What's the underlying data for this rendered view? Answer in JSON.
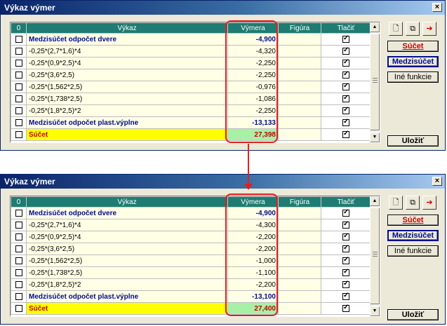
{
  "windows": [
    {
      "title": "Výkaz výmer",
      "columns": [
        "0",
        "Výkaz",
        "Výmera",
        "Figúra",
        "Tlačiť"
      ],
      "rows": [
        {
          "type": "sub",
          "vykaz": "Medzisúčet odpočet dvere",
          "vymera": "-4,900",
          "tlacit": true
        },
        {
          "type": "item",
          "vykaz": "-0,25*(2,7*1,6)*4",
          "vymera": "-4,320",
          "tlacit": true
        },
        {
          "type": "item",
          "vykaz": "-0,25*(0,9*2,5)*4",
          "vymera": "-2,250",
          "tlacit": true
        },
        {
          "type": "item",
          "vykaz": "-0,25*(3,6*2,5)",
          "vymera": "-2,250",
          "tlacit": true
        },
        {
          "type": "item",
          "vykaz": "-0,25*(1,562*2,5)",
          "vymera": "-0,976",
          "tlacit": true
        },
        {
          "type": "item",
          "vykaz": "-0,25*(1,738*2,5)",
          "vymera": "-1,086",
          "tlacit": true
        },
        {
          "type": "item",
          "vykaz": "-0,25*(1,8*2,5)*2",
          "vymera": "-2,250",
          "tlacit": true
        },
        {
          "type": "sub",
          "vykaz": "Medzisúčet odpočet plast.výplne",
          "vymera": "-13,133",
          "tlacit": true
        },
        {
          "type": "tot",
          "vykaz": "Súčet",
          "vymera": "27,398",
          "tlacit": true
        }
      ],
      "buttons": {
        "sucet": "Súčet",
        "medzisucet": "Medzisúčet",
        "ine": "Iné funkcie",
        "ulozit": "Uložiť"
      },
      "close_label": "×"
    },
    {
      "title": "Výkaz výmer",
      "columns": [
        "0",
        "Výkaz",
        "Výmera",
        "Figúra",
        "Tlačiť"
      ],
      "rows": [
        {
          "type": "sub",
          "vykaz": "Medzisúčet odpočet dvere",
          "vymera": "-4,900",
          "tlacit": true
        },
        {
          "type": "item",
          "vykaz": "-0,25*(2,7*1,6)*4",
          "vymera": "-4,300",
          "tlacit": true
        },
        {
          "type": "item",
          "vykaz": "-0,25*(0,9*2,5)*4",
          "vymera": "-2,200",
          "tlacit": true
        },
        {
          "type": "item",
          "vykaz": "-0,25*(3,6*2,5)",
          "vymera": "-2,200",
          "tlacit": true
        },
        {
          "type": "item",
          "vykaz": "-0,25*(1,562*2,5)",
          "vymera": "-1,000",
          "tlacit": true
        },
        {
          "type": "item",
          "vykaz": "-0,25*(1,738*2,5)",
          "vymera": "-1,100",
          "tlacit": true
        },
        {
          "type": "item",
          "vykaz": "-0,25*(1,8*2,5)*2",
          "vymera": "-2,200",
          "tlacit": true
        },
        {
          "type": "sub",
          "vykaz": "Medzisúčet odpočet plast.výplne",
          "vymera": "-13,100",
          "tlacit": true
        },
        {
          "type": "tot",
          "vykaz": "Súčet",
          "vymera": "27,400",
          "tlacit": true
        }
      ],
      "buttons": {
        "sucet": "Súčet",
        "medzisucet": "Medzisúčet",
        "ine": "Iné funkcie",
        "ulozit": "Uložiť"
      },
      "close_label": "×"
    }
  ],
  "colors": {
    "highlight": "#e02020",
    "subtotal_text": "#000c8c",
    "total_text": "#c80000",
    "total_label_bg": "#ffff00",
    "total_value_bg": "#a8f0a8",
    "header_bg": "#1e7c72"
  },
  "icons": [
    "insert-row-icon",
    "copy-row-icon",
    "export-icon"
  ]
}
